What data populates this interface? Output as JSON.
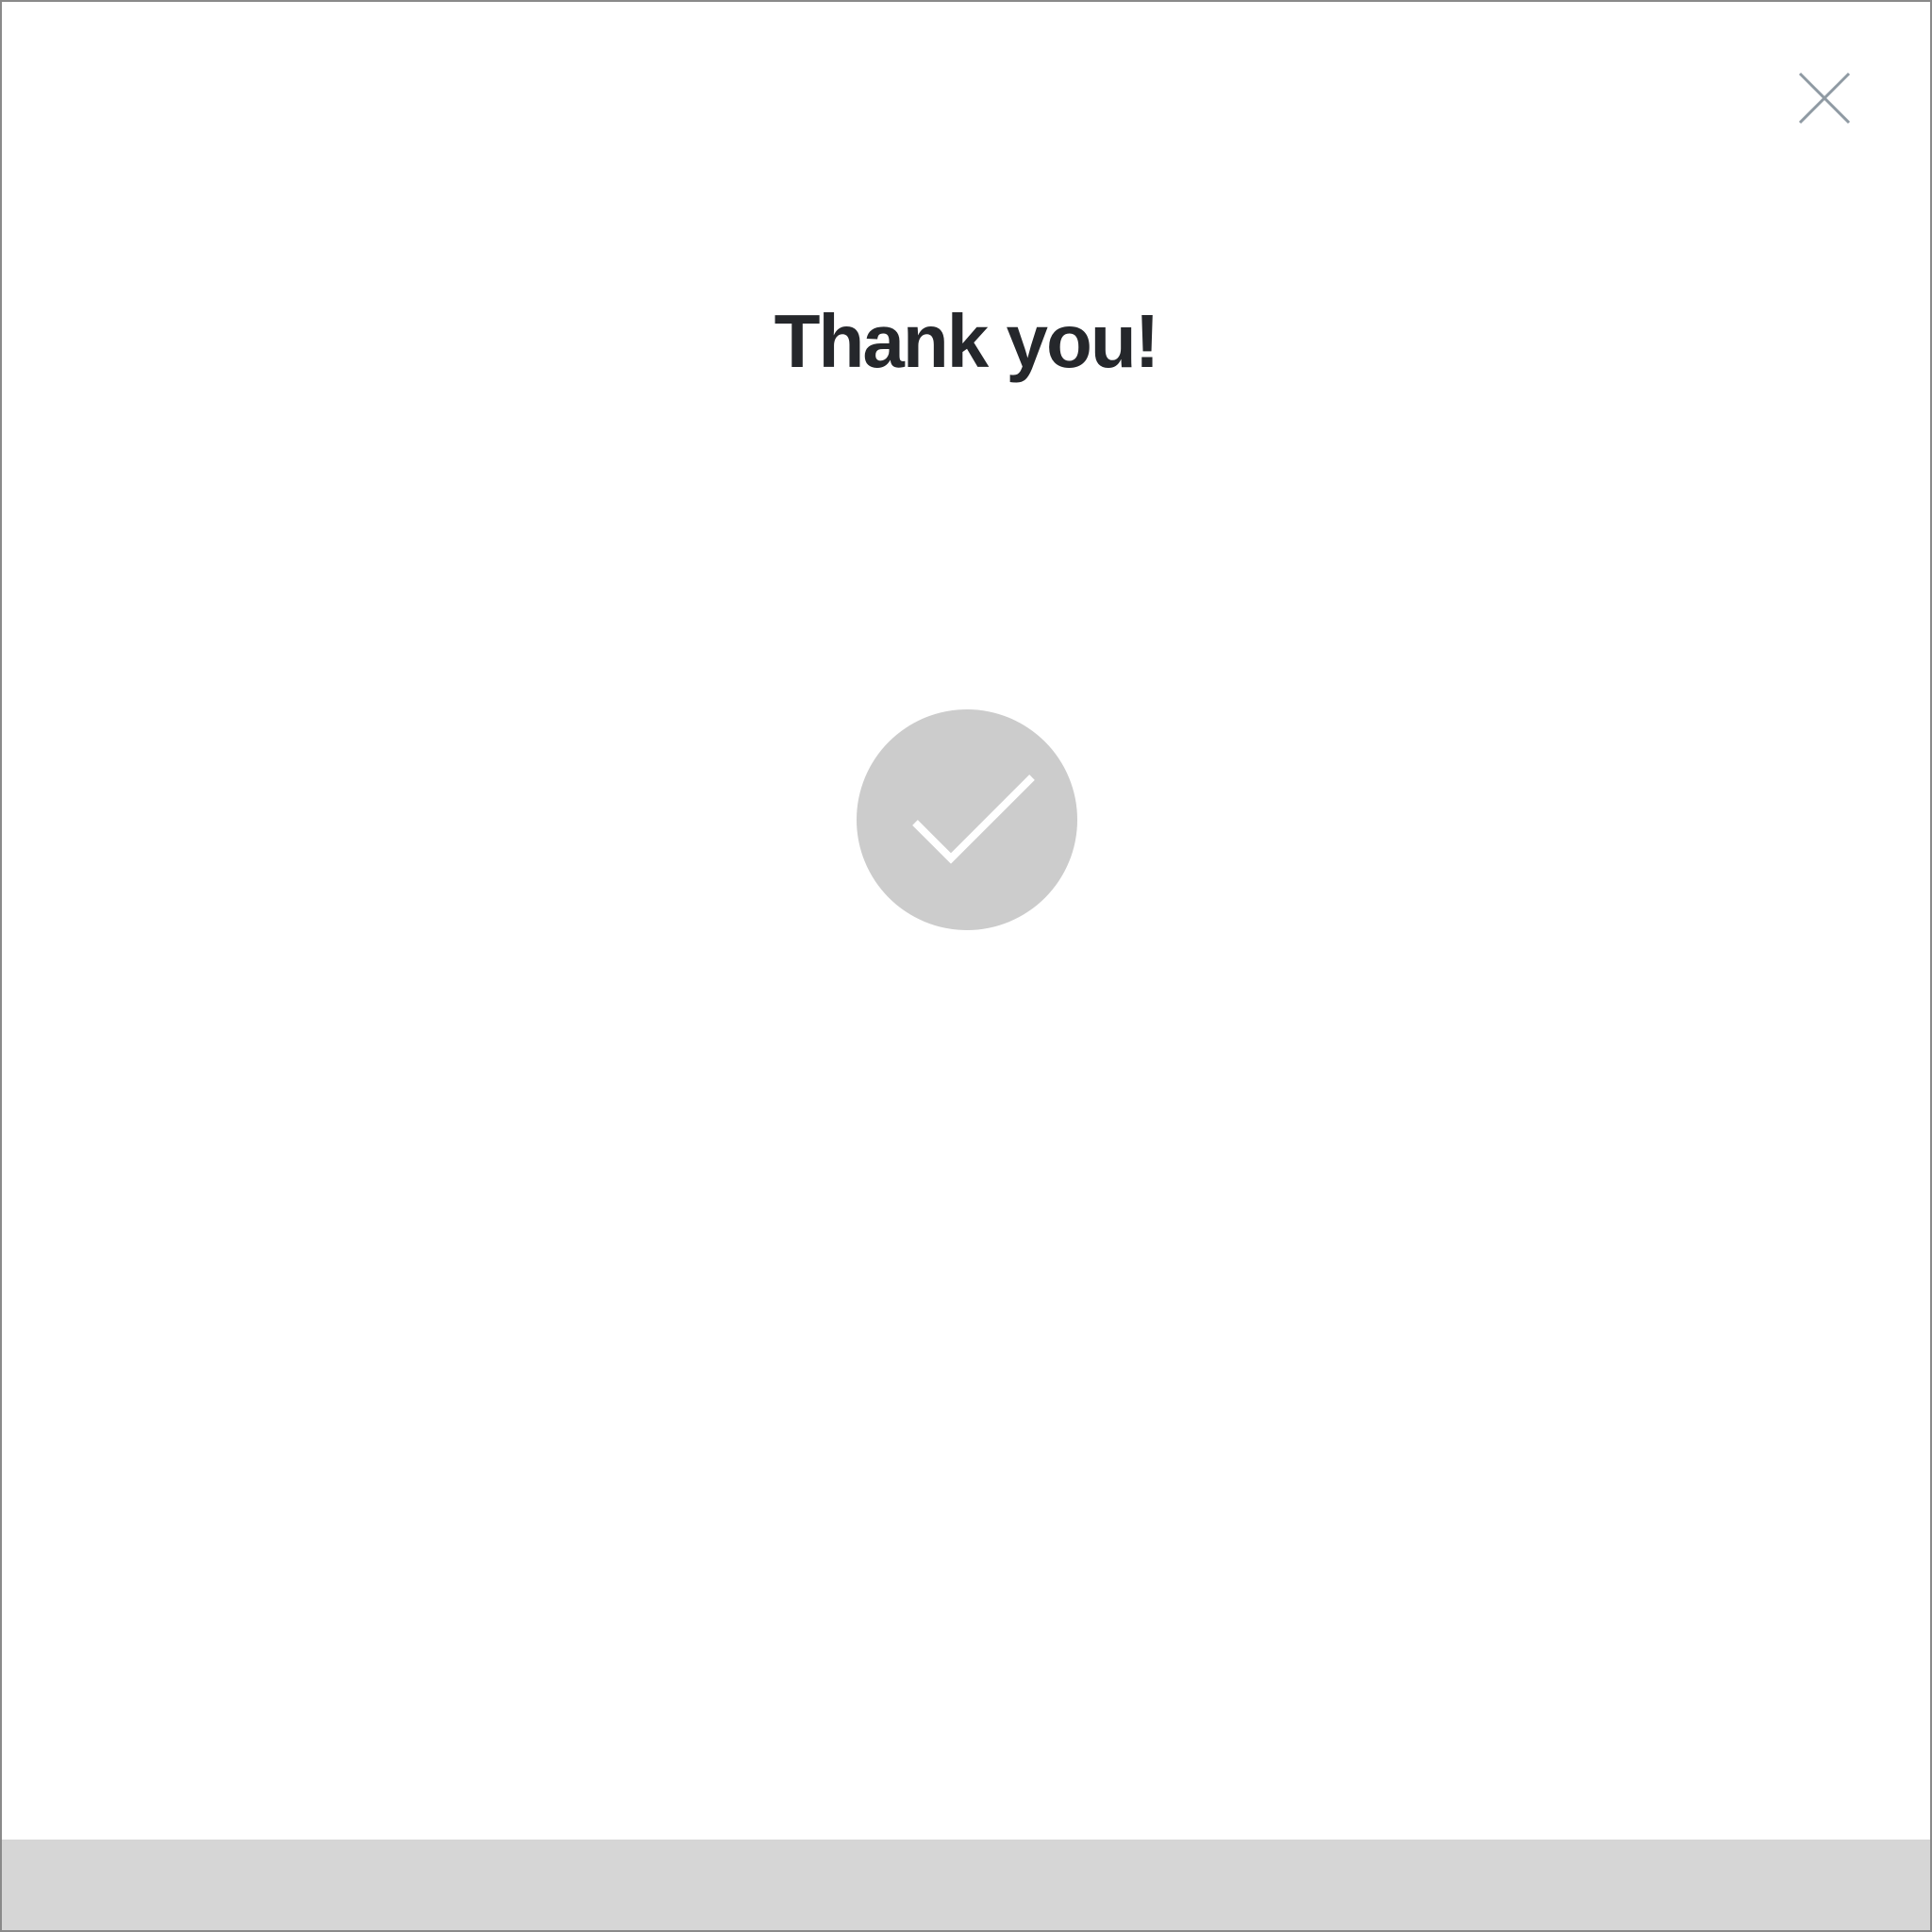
{
  "dialog": {
    "title": "Thank you!",
    "close_icon": "close-icon",
    "success_icon": "checkmark-circle-icon"
  },
  "colors": {
    "title": "#25272b",
    "close_icon": "#8f9aa3",
    "success_circle": "#cccccc",
    "checkmark": "#ffffff",
    "footer": "#d6d6d6",
    "border": "#8a8a8a"
  }
}
